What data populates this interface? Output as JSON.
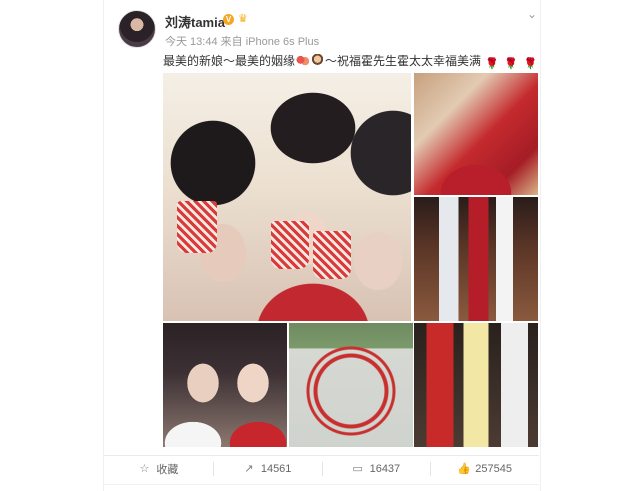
{
  "post": {
    "username": "刘涛tamia",
    "verified_badge": "V",
    "crown_icon": "crown-icon",
    "timestamp": "今天 13:44",
    "source": "来自 iPhone 6s Plus",
    "text_part1": "最美的新娘～最美的姻缘",
    "text_part2": "～祝福霍先生霍太太幸福美满",
    "rose_glyph": "🌹"
  },
  "actions": {
    "favorite_label": "收藏",
    "repost_count": "14561",
    "comment_count": "16437",
    "like_count": "257545"
  },
  "colors": {
    "accent_red": "#c8302f",
    "verified_orange": "#f5a623",
    "meta_gray": "#999999"
  }
}
